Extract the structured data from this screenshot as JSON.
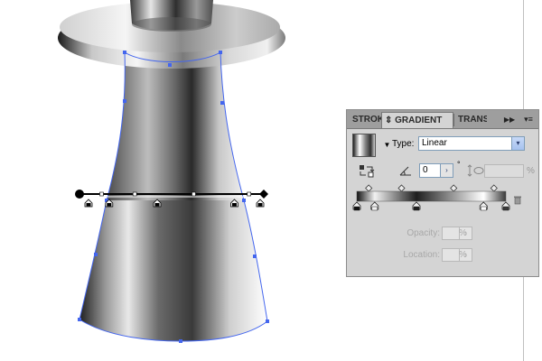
{
  "panel": {
    "tabs": [
      {
        "label": "STROKE"
      },
      {
        "label": "⇕ GRADIENT"
      },
      {
        "label": "TRANSPARENCY"
      }
    ],
    "collapse_glyph": "▶▶",
    "menu_glyph": "▾≡",
    "swatch_arrow_glyph": "▼",
    "type": {
      "label": "Type:",
      "value": "Linear",
      "arrow_glyph": "▾"
    },
    "angle": {
      "value": "0",
      "stepper_glyph": "›",
      "degree": "°"
    },
    "aspect": {
      "unit": "%"
    },
    "slider": {
      "stops": [
        {
          "location": 0,
          "color": "#111111"
        },
        {
          "location": 0.12,
          "color": "#f2f2f2"
        },
        {
          "location": 0.4,
          "color": "#1e1e1e"
        },
        {
          "location": 0.85,
          "color": "#ffffff"
        },
        {
          "location": 1.0,
          "color": "#3a3a3a"
        }
      ],
      "midpoints": [
        0.08,
        0.3,
        0.65,
        0.92
      ]
    },
    "opacity": {
      "label": "Opacity:",
      "unit": "%",
      "stepper_glyph": "›"
    },
    "location": {
      "label": "Location:",
      "unit": "%",
      "stepper_glyph": "›"
    }
  },
  "canvas": {
    "selection_color": "#4466ee",
    "gradient_annotator": {
      "stops": [
        0,
        0.12,
        0.4,
        0.85,
        1.0
      ]
    }
  }
}
